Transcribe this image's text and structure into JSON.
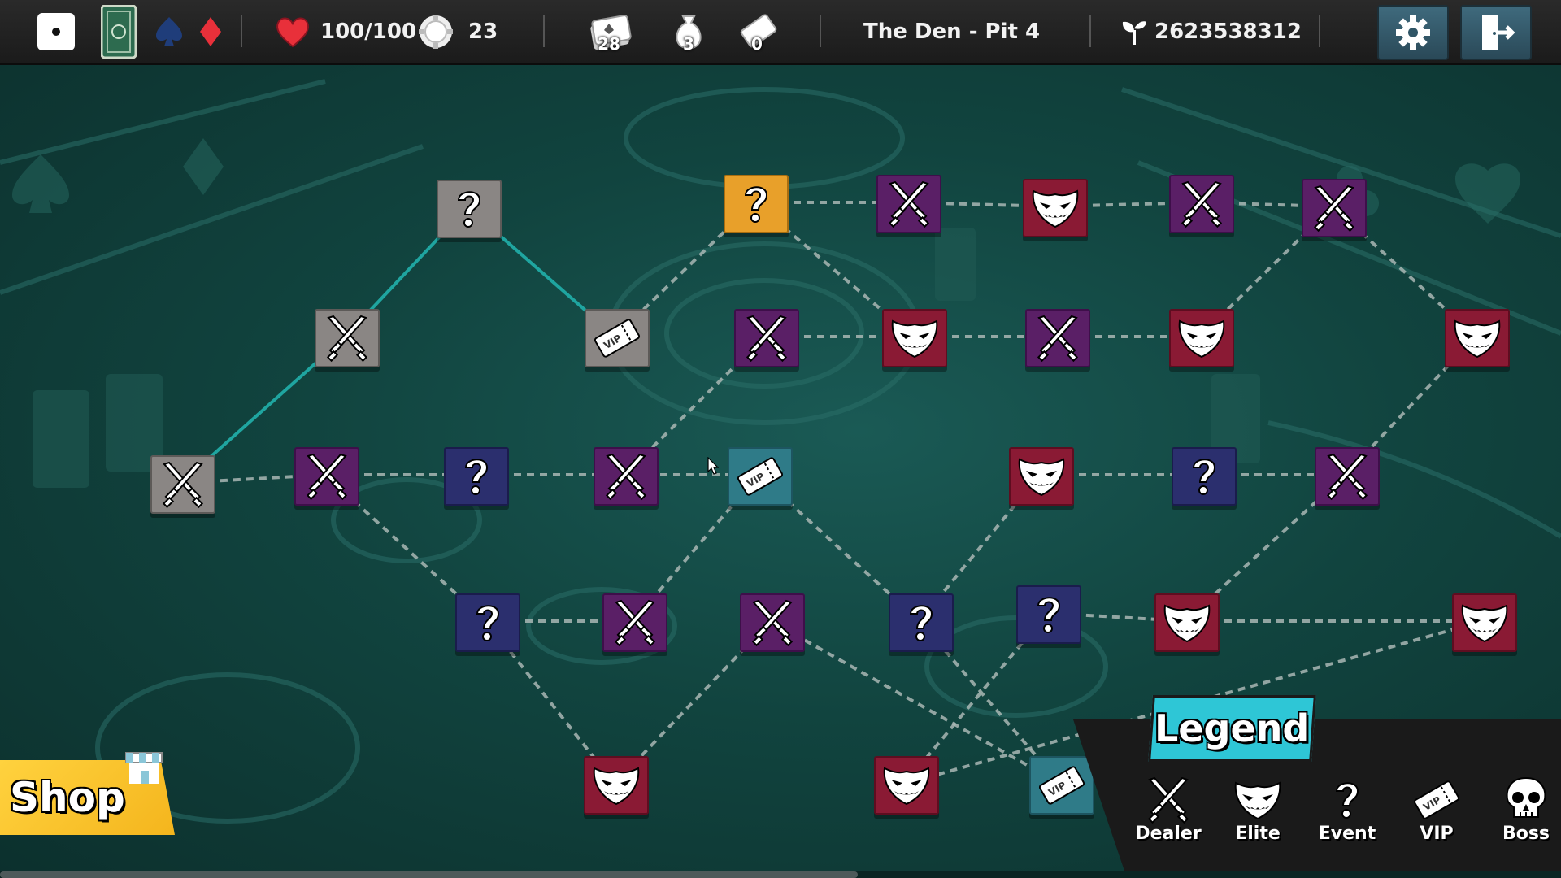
{
  "topbar": {
    "health": "100/100",
    "chips": "23",
    "deck_count": "28",
    "bag_count": "3",
    "ticket_count": "0",
    "location": "The Den - Pit 4",
    "seed": "2623538312",
    "colors": {
      "heart": "#e8303a",
      "diamond": "#e8303a",
      "spade": "#1f3d7a"
    }
  },
  "map": {
    "nodes": [
      {
        "id": "n01",
        "type": "visited",
        "icon": "question-icon",
        "col": 0,
        "row": 0
      },
      {
        "id": "n02",
        "type": "visited",
        "icon": "swords-icon",
        "col": 1,
        "row": 1
      },
      {
        "id": "n03",
        "type": "visited",
        "icon": "swords-icon",
        "col": 2,
        "row": 2
      },
      {
        "id": "n04",
        "type": "visited",
        "icon": "vip-ticket-icon",
        "col": 3,
        "row": 3
      },
      {
        "id": "n05",
        "type": "current",
        "icon": "question-icon",
        "col": 4,
        "row": 4
      },
      {
        "id": "n06",
        "type": "dealer",
        "icon": "swords-icon",
        "col": 5,
        "row": 5
      },
      {
        "id": "n07",
        "type": "elite",
        "icon": "mask-icon",
        "col": 6,
        "row": 6
      },
      {
        "id": "n08",
        "type": "dealer",
        "icon": "swords-icon",
        "col": 7,
        "row": 7
      },
      {
        "id": "n09",
        "type": "dealer",
        "icon": "swords-icon",
        "col": 8,
        "row": 8
      },
      {
        "id": "n10",
        "type": "dealer",
        "icon": "swords-icon",
        "col": 9,
        "row": 9
      },
      {
        "id": "n11",
        "type": "elite",
        "icon": "mask-icon",
        "col": 10,
        "row": 10
      },
      {
        "id": "n12",
        "type": "elite",
        "icon": "mask-icon",
        "col": 11,
        "row": 11
      },
      {
        "id": "n13",
        "type": "dealer",
        "icon": "swords-icon",
        "col": 12,
        "row": 12
      },
      {
        "id": "n14",
        "type": "elite",
        "icon": "mask-icon",
        "col": 13,
        "row": 13
      },
      {
        "id": "n15",
        "type": "elite",
        "icon": "mask-icon",
        "col": 14,
        "row": 14
      },
      {
        "id": "n16",
        "type": "dealer",
        "icon": "swords-icon",
        "col": 15,
        "row": 15
      },
      {
        "id": "n17",
        "type": "event",
        "icon": "question-icon",
        "col": 16,
        "row": 16
      },
      {
        "id": "n18",
        "type": "dealer",
        "icon": "swords-icon",
        "col": 17,
        "row": 17
      },
      {
        "id": "n19",
        "type": "vip",
        "icon": "vip-ticket-icon",
        "col": 18,
        "row": 18
      },
      {
        "id": "n20",
        "type": "elite",
        "icon": "mask-icon",
        "col": 19,
        "row": 19
      },
      {
        "id": "n21",
        "type": "event",
        "icon": "question-icon",
        "col": 20,
        "row": 20
      },
      {
        "id": "n22",
        "type": "dealer",
        "icon": "swords-icon",
        "col": 21,
        "row": 21
      },
      {
        "id": "n23",
        "type": "event",
        "icon": "question-icon",
        "col": 22,
        "row": 22
      },
      {
        "id": "n24",
        "type": "dealer",
        "icon": "swords-icon",
        "col": 23,
        "row": 23
      },
      {
        "id": "n25",
        "type": "dealer",
        "icon": "swords-icon",
        "col": 24,
        "row": 24
      },
      {
        "id": "n26",
        "type": "event",
        "icon": "question-icon",
        "col": 25,
        "row": 25
      },
      {
        "id": "n27",
        "type": "event",
        "icon": "question-icon",
        "col": 26,
        "row": 26
      },
      {
        "id": "n28",
        "type": "elite",
        "icon": "mask-icon",
        "col": 27,
        "row": 27
      },
      {
        "id": "n29",
        "type": "elite",
        "icon": "mask-icon",
        "col": 28,
        "row": 28
      },
      {
        "id": "n30",
        "type": "elite",
        "icon": "mask-icon",
        "col": 29,
        "row": 29
      },
      {
        "id": "n31",
        "type": "vip",
        "icon": "vip-ticket-icon",
        "col": 30,
        "row": 30
      },
      {
        "id": "n32",
        "type": "dealer",
        "icon": "swords-icon",
        "col": 31,
        "row": 31
      }
    ]
  },
  "shop": {
    "label": "Shop"
  },
  "legend": {
    "title": "Legend",
    "items": [
      {
        "label": "Dealer",
        "icon": "swords-icon"
      },
      {
        "label": "Elite",
        "icon": "mask-icon"
      },
      {
        "label": "Event",
        "icon": "question-icon"
      },
      {
        "label": "VIP",
        "icon": "vip-ticket-icon"
      },
      {
        "label": "Boss",
        "icon": "skull-icon"
      }
    ]
  }
}
